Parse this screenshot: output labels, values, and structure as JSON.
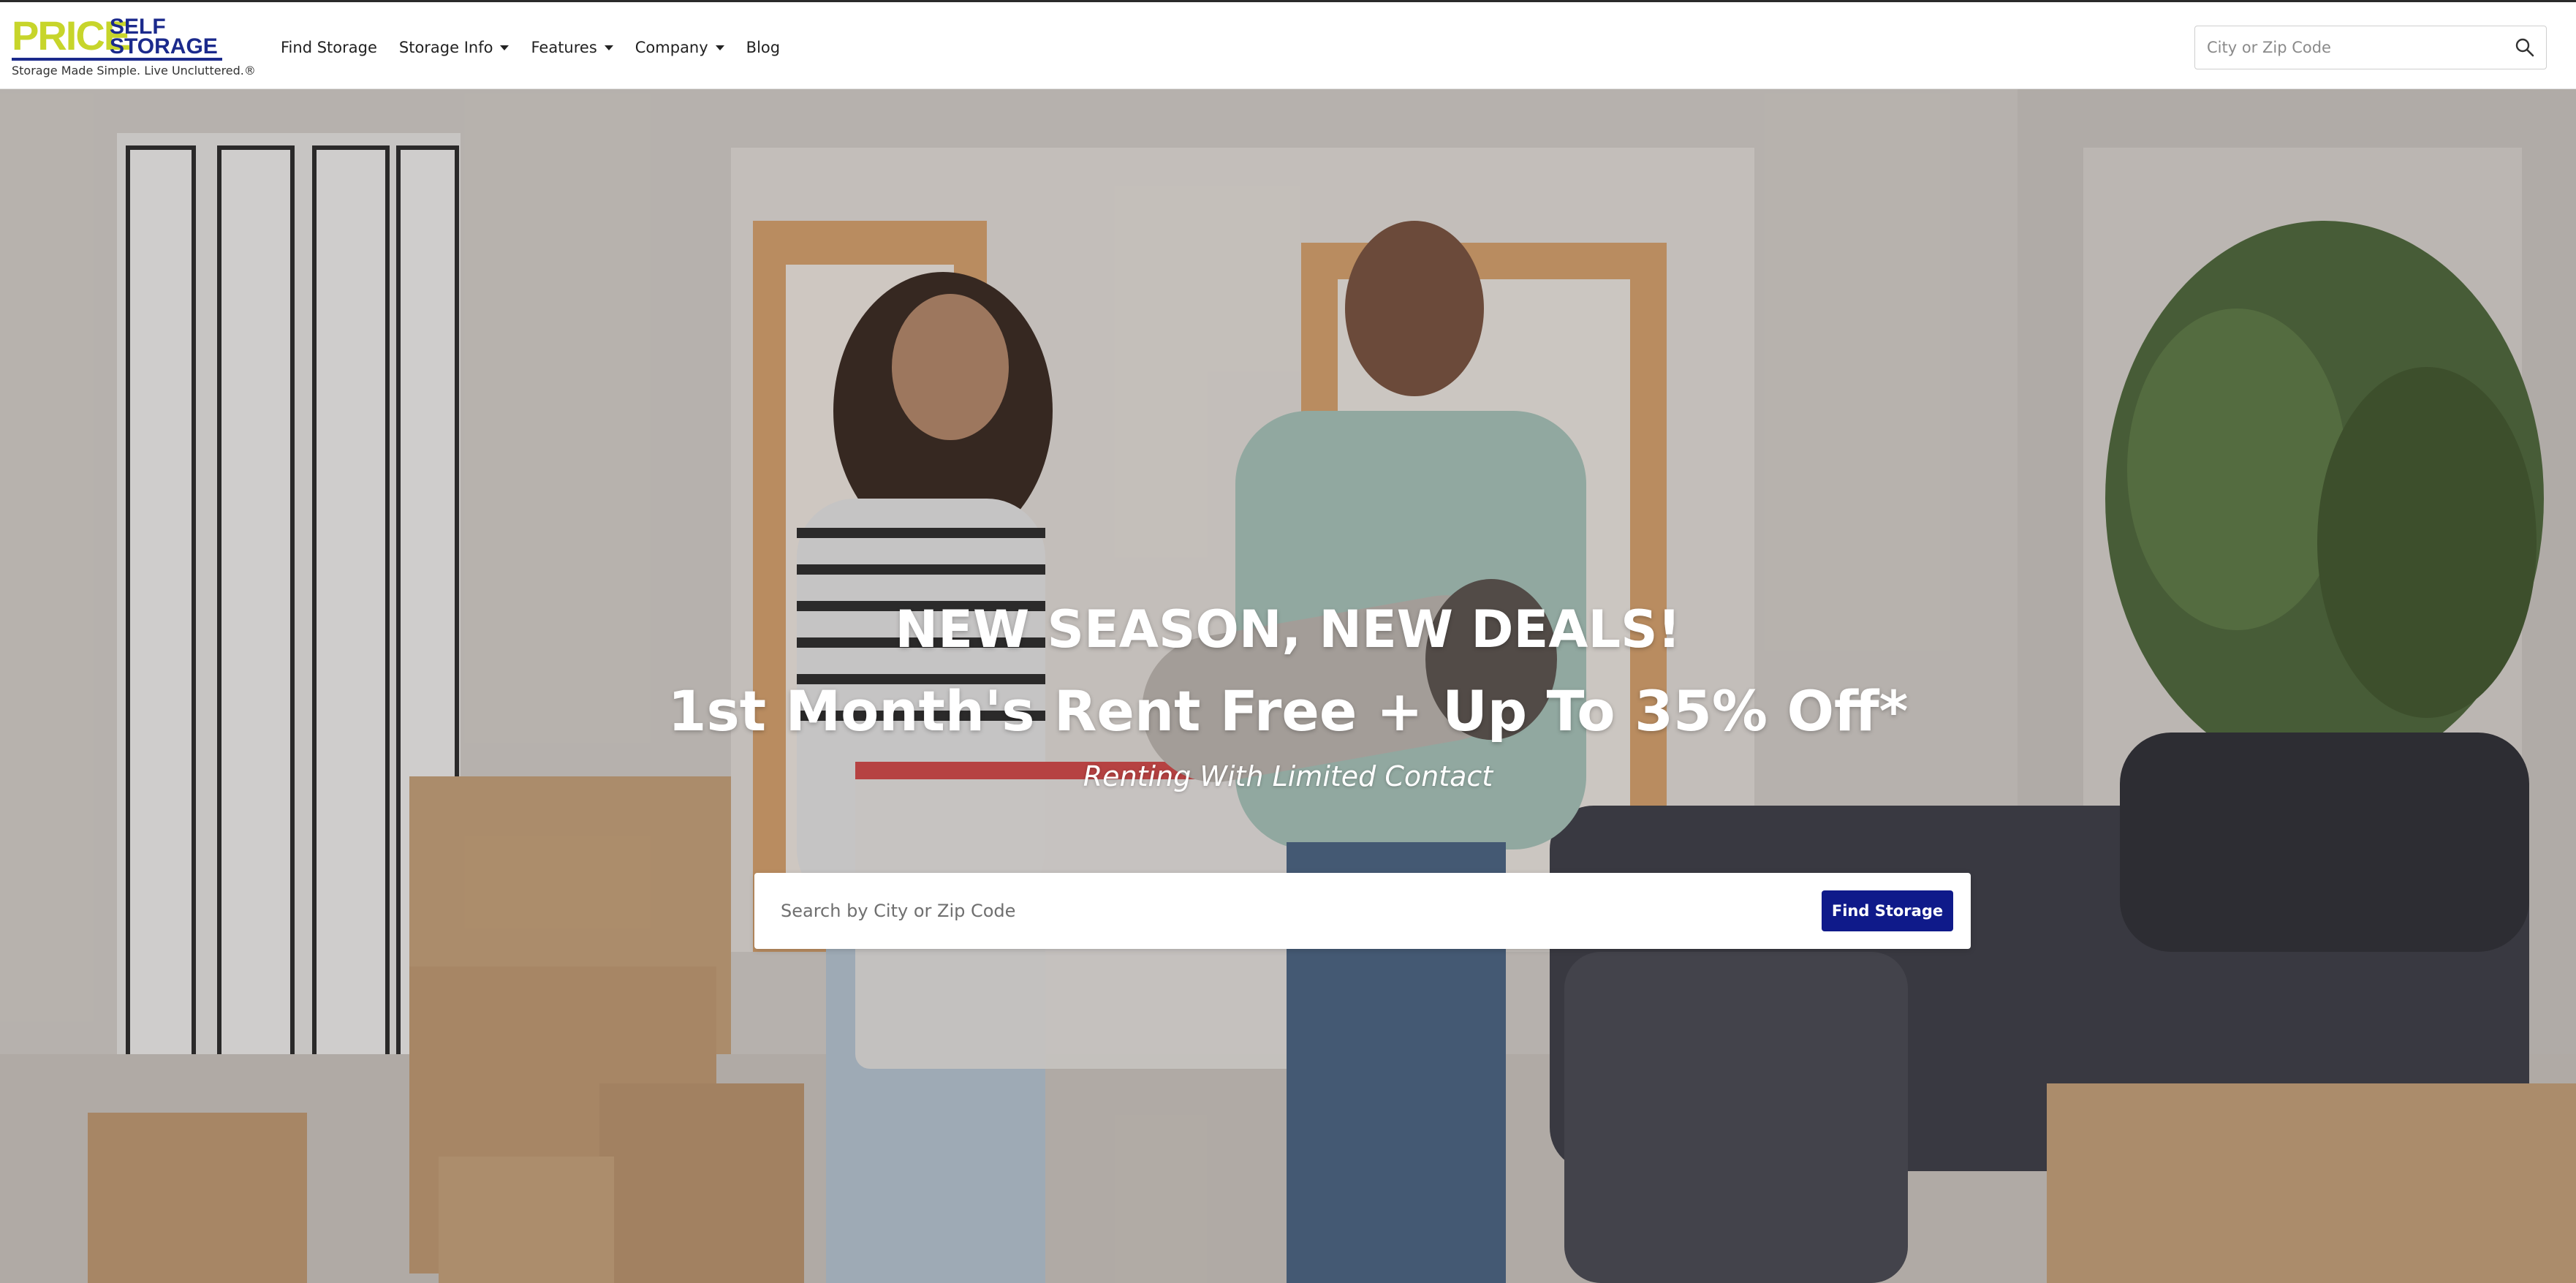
{
  "header": {
    "logo": {
      "price": "PRICE",
      "self": "SELF",
      "storage": "STORAGE",
      "registered": "®",
      "tagline": "Storage Made Simple. Live Uncluttered.®",
      "colors": {
        "lime": "#c7d52b",
        "navy": "#1b2a8c"
      }
    },
    "nav": {
      "items": [
        {
          "label": "Find Storage",
          "has_dropdown": false
        },
        {
          "label": "Storage Info",
          "has_dropdown": true
        },
        {
          "label": "Features",
          "has_dropdown": true
        },
        {
          "label": "Company",
          "has_dropdown": true
        },
        {
          "label": "Blog",
          "has_dropdown": false
        }
      ]
    },
    "search": {
      "placeholder": "City or Zip Code",
      "icon": "search-icon"
    }
  },
  "hero": {
    "title": "NEW SEASON, NEW DEALS!",
    "subtitle": "1st Month's Rent Free + Up To 35% Off*",
    "tagline": "Renting With Limited Contact",
    "search": {
      "placeholder": "Search by City or Zip Code",
      "button_label": "Find Storage",
      "button_color": "#0f1a8a"
    }
  }
}
